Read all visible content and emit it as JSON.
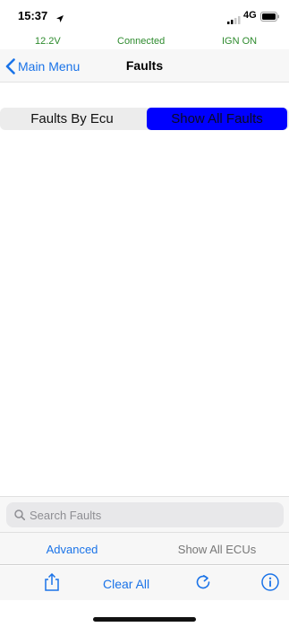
{
  "status_bar": {
    "time": "15:37",
    "network": "4G",
    "icons": [
      "location-arrow-icon",
      "signal-bars-icon",
      "battery-icon"
    ]
  },
  "vehicle_status": {
    "voltage": "12.2V",
    "connection": "Connected",
    "ignition": "IGN ON",
    "color": "#2e8b2e"
  },
  "nav": {
    "back_label": "Main Menu",
    "back_icon": "chevron-left-icon",
    "title": "Faults"
  },
  "segments": {
    "by_ecu": "Faults By Ecu",
    "show_all": "Show All Faults",
    "selected": "show_all",
    "selected_color": "#0000ff"
  },
  "search": {
    "placeholder": "Search Faults",
    "value": "",
    "icon": "search-icon"
  },
  "options": {
    "advanced": "Advanced",
    "show_all_ecus": "Show All ECUs"
  },
  "toolbar": {
    "share_icon": "share-icon",
    "clear_all": "Clear All",
    "refresh_icon": "refresh-icon",
    "info_icon": "info-icon"
  },
  "colors": {
    "accent": "#1a73e8",
    "status_green": "#2e8b2e"
  }
}
